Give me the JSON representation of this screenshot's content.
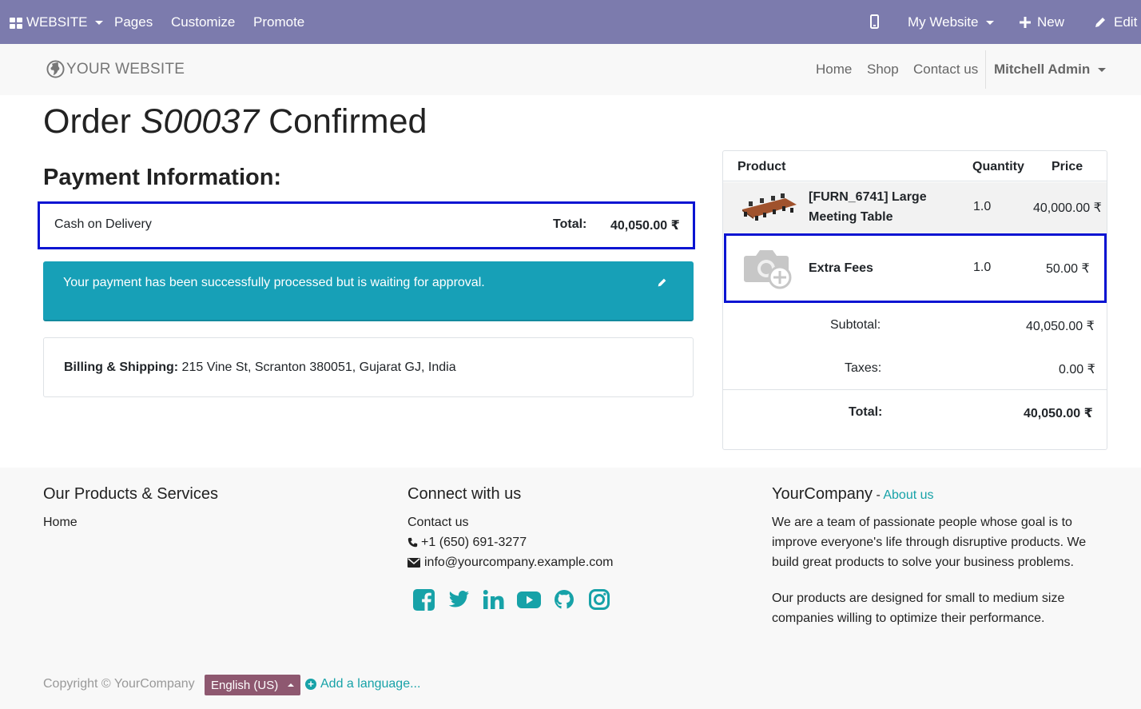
{
  "adminbar": {
    "app_label": "WEBSITE",
    "menu": [
      "Pages",
      "Customize",
      "Promote"
    ],
    "my_website": "My Website",
    "new_label": "New",
    "edit_label": "Edit"
  },
  "site": {
    "logo_text": "YOUR WEBSITE",
    "nav": [
      "Home",
      "Shop",
      "Contact us"
    ],
    "user": "Mitchell Admin"
  },
  "order": {
    "title_prefix": "Order",
    "number": "S00037",
    "title_suffix": "Confirmed",
    "payment_heading": "Payment Information:",
    "payment_method": "Cash on Delivery",
    "total_label": "Total:",
    "total_value": "40,050.00 ₹",
    "alert_message": "Your payment has been successfully processed but is waiting for approval.",
    "billing_label": "Billing & Shipping:",
    "billing_address": "215 Vine St, Scranton 380051, Gujarat GJ, India"
  },
  "cart": {
    "headers": {
      "product": "Product",
      "quantity": "Quantity",
      "price": "Price"
    },
    "lines": [
      {
        "name_line1": "[FURN_6741] Large",
        "name_line2": "Meeting Table",
        "qty": "1.0",
        "price": "40,000.00 ₹"
      },
      {
        "name_line1": "Extra Fees",
        "qty": "1.0",
        "price": "50.00 ₹"
      }
    ],
    "subtotal_label": "Subtotal:",
    "subtotal_value": "40,050.00 ₹",
    "taxes_label": "Taxes:",
    "taxes_value": "0.00 ₹",
    "total_label": "Total:",
    "total_value": "40,050.00 ₹"
  },
  "footer": {
    "col1_title": "Our Products & Services",
    "col1_link": "Home",
    "col2_title": "Connect with us",
    "col2_link": "Contact us",
    "phone": "+1 (650) 691-3277",
    "email": "info@yourcompany.example.com",
    "col3_title": "YourCompany",
    "col3_sep": " - ",
    "col3_link": "About us",
    "about_p1_l1": "We are a team of passionate people whose goal is to",
    "about_p1_l2": "improve everyone's life through disruptive products. We",
    "about_p1_l3": "build great products to solve your business problems.",
    "about_p2_l1": "Our products are designed for small to medium size",
    "about_p2_l2": "companies willing to optimize their performance.",
    "copyright": "Copyright © YourCompany",
    "language": "English (US)",
    "add_language": "Add a language...",
    "social_icons": [
      "facebook-icon",
      "twitter-icon",
      "linkedin-icon",
      "youtube-icon",
      "github-icon",
      "instagram-icon"
    ]
  },
  "colors": {
    "adminbar": "#7c7bad",
    "accent": "#17a2a8",
    "alert": "#17a0b7",
    "highlight": "#0a14d2",
    "language_badge": "#8e5870"
  }
}
